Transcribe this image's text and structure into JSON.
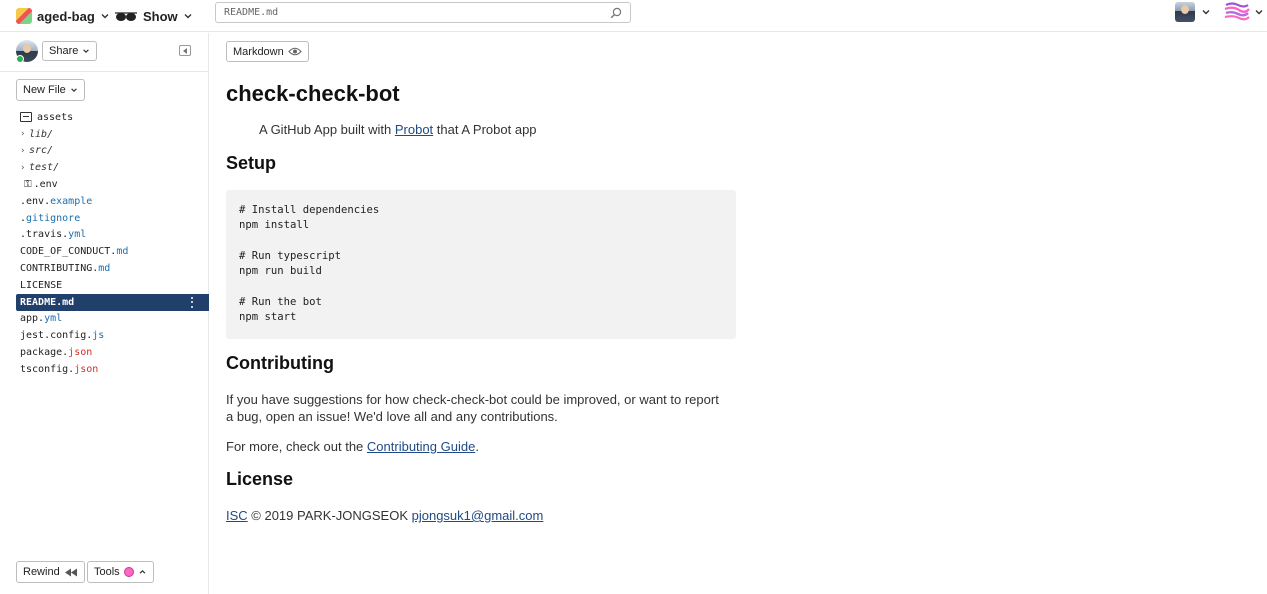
{
  "topbar": {
    "project_name": "aged-bag",
    "show_label": "Show",
    "search_value": "README.md"
  },
  "sidebar": {
    "share_label": "Share",
    "new_file_label": "New File",
    "files": [
      {
        "name": "assets",
        "ext": "",
        "type": "assets"
      },
      {
        "name": "lib/",
        "ext": "",
        "type": "folder"
      },
      {
        "name": "src/",
        "ext": "",
        "type": "folder"
      },
      {
        "name": "test/",
        "ext": "",
        "type": "folder"
      },
      {
        "name": ".env",
        "ext": "",
        "type": "env"
      },
      {
        "name": ".env.",
        "ext": "example",
        "type": "file"
      },
      {
        "name": ".",
        "ext": "gitignore",
        "type": "file"
      },
      {
        "name": ".travis.",
        "ext": "yml",
        "type": "file"
      },
      {
        "name": "CODE_OF_CONDUCT.",
        "ext": "md",
        "type": "file"
      },
      {
        "name": "CONTRIBUTING.",
        "ext": "md",
        "type": "file"
      },
      {
        "name": "LICENSE",
        "ext": "",
        "type": "file"
      },
      {
        "name": "README.",
        "ext": "md",
        "type": "file",
        "selected": true
      },
      {
        "name": "app.",
        "ext": "yml",
        "type": "file"
      },
      {
        "name": "jest.config.",
        "ext": "js",
        "type": "file"
      },
      {
        "name": "package.",
        "ext": "json",
        "type": "file",
        "ext_color": "red"
      },
      {
        "name": "tsconfig.",
        "ext": "json",
        "type": "file",
        "ext_color": "red"
      }
    ],
    "rewind_label": "Rewind",
    "tools_label": "Tools"
  },
  "main": {
    "markdown_label": "Markdown",
    "title": "check-check-bot",
    "tagline_pre": "A GitHub App built with ",
    "tagline_link": "Probot",
    "tagline_post": " that A Probot app",
    "setup_heading": "Setup",
    "code_block": "# Install dependencies\nnpm install\n\n# Run typescript\nnpm run build\n\n# Run the bot\nnpm start",
    "contributing_heading": "Contributing",
    "contrib_text": "If you have suggestions for how check-check-bot could be improved, or want to report a bug, open an issue! We'd love all and any contributions.",
    "more_pre": "For more, check out the ",
    "more_link": "Contributing Guide",
    "more_post": ".",
    "license_heading": "License",
    "license_link": "ISC",
    "license_text": " © 2019 PARK-JONGSEOK ",
    "email_link": "pjongsuk1@gmail.com"
  },
  "colors": {
    "selected_bg": "#213f6b",
    "link": "#1f4a85",
    "ext_blue": "#1a6fb0",
    "ext_red": "#d0312d",
    "online": "#2bb352",
    "tools_dot": "#ff66c4"
  }
}
